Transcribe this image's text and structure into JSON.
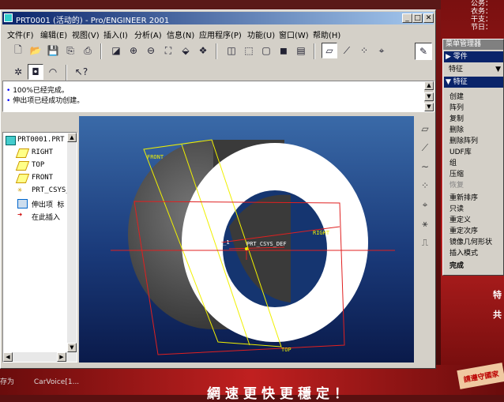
{
  "window": {
    "title": "PRT0001 (活动的) - Pro/ENGINEER 2001"
  },
  "menubar": [
    {
      "label": "文件(F)"
    },
    {
      "label": "编辑(E)"
    },
    {
      "label": "视图(V)"
    },
    {
      "label": "插入(I)"
    },
    {
      "label": "分析(A)"
    },
    {
      "label": "信息(N)"
    },
    {
      "label": "应用程序(P)"
    },
    {
      "label": "功能(U)"
    },
    {
      "label": "窗口(W)"
    },
    {
      "label": "帮助(H)"
    }
  ],
  "messages": [
    {
      "text": "100%已经完成。"
    },
    {
      "text": "伸出项已经成功创建。"
    }
  ],
  "model_tree": [
    {
      "text": "PRT0001.PRT",
      "icon": "part-icon"
    },
    {
      "text": "RIGHT",
      "icon": "datum-plane-icon"
    },
    {
      "text": "TOP",
      "icon": "datum-plane-icon"
    },
    {
      "text": "FRONT",
      "icon": "datum-plane-icon"
    },
    {
      "text": "PRT_CSYS_",
      "icon": "csys-icon"
    },
    {
      "text": "伸出项 标",
      "icon": "protrusion-icon"
    },
    {
      "text": "在此插入",
      "icon": "insert-here-icon"
    }
  ],
  "viewport": {
    "labels": {
      "front": "FRONT",
      "right": "RIGHT",
      "top": "TOP",
      "csys": "PRT_CSYS_DEF",
      "axis": "A_1"
    },
    "colors": {
      "front_plane": "#f0f000",
      "right_plane": "#e02020",
      "ring": "#ffffff",
      "shadow": "#505050"
    }
  },
  "menu_manager": {
    "header": "菜单管理器",
    "section_part": "零件",
    "dropdown": "特征",
    "section_feature": "特征",
    "items": [
      {
        "label": "创建",
        "state": "normal"
      },
      {
        "label": "阵列",
        "state": "normal"
      },
      {
        "label": "复制",
        "state": "normal"
      },
      {
        "label": "删除",
        "state": "normal"
      },
      {
        "label": "删除阵列",
        "state": "normal"
      },
      {
        "label": "UDF库",
        "state": "normal"
      },
      {
        "label": "组",
        "state": "normal"
      },
      {
        "label": "压缩",
        "state": "normal"
      },
      {
        "label": "恢复",
        "state": "disabled"
      },
      {
        "label": "重新排序",
        "state": "normal"
      },
      {
        "label": "只读",
        "state": "normal"
      },
      {
        "label": "重定义",
        "state": "normal"
      },
      {
        "label": "重定次序",
        "state": "normal"
      },
      {
        "label": "镜像几何形状",
        "state": "normal"
      },
      {
        "label": "插入模式",
        "state": "normal"
      },
      {
        "label": "完成",
        "state": "bold"
      }
    ]
  },
  "desktop": {
    "right_info": [
      "公务：",
      "衣务：",
      "干支：",
      "节日："
    ],
    "right_chars": [
      "特",
      "共"
    ],
    "slogan": "網速更快更穩定！",
    "badge": "請遵守國家",
    "taskbar": [
      "存为",
      "CarVoice[1..."
    ]
  }
}
